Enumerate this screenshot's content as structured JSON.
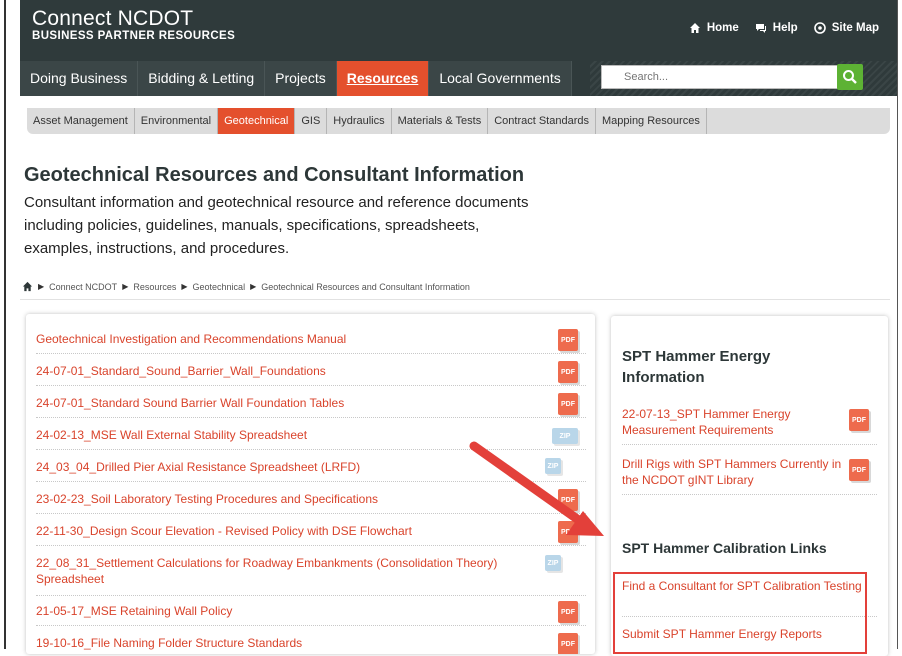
{
  "header": {
    "brand_name": "Connect NCDOT",
    "brand_sub": "BUSINESS PARTNER RESOURCES",
    "top_links": [
      {
        "label": "Home",
        "icon": "home-icon"
      },
      {
        "label": "Help",
        "icon": "chat-icon"
      },
      {
        "label": "Site Map",
        "icon": "sitemap-icon"
      }
    ],
    "nav": [
      "Doing Business",
      "Bidding & Letting",
      "Projects",
      "Resources",
      "Local Governments"
    ],
    "nav_active": "Resources",
    "search_placeholder": "Search..."
  },
  "subnav": {
    "items": [
      "Asset Management",
      "Environmental",
      "Geotechnical",
      "GIS",
      "Hydraulics",
      "Materials & Tests",
      "Contract Standards",
      "Mapping Resources"
    ],
    "active": "Geotechnical"
  },
  "page": {
    "title": "Geotechnical Resources and Consultant Information",
    "intro": "Consultant information and geotechnical resource and reference documents including policies, guidelines, manuals, specifications, spreadsheets, examples, instructions, and procedures."
  },
  "breadcrumb": [
    "Connect NCDOT",
    "Resources",
    "Geotechnical",
    "Geotechnical Resources and Consultant Information"
  ],
  "documents": [
    {
      "title": "Geotechnical Investigation and Recommendations Manual",
      "type": "PDF"
    },
    {
      "title": "24-07-01_Standard_Sound_Barrier_Wall_Foundations",
      "type": "PDF"
    },
    {
      "title": "24-07-01_Standard Sound Barrier Wall Foundation Tables",
      "type": "PDF"
    },
    {
      "title": "24-02-13_MSE Wall External Stability Spreadsheet",
      "type": "ZIP"
    },
    {
      "title": "24_03_04_Drilled Pier Axial Resistance Spreadsheet (LRFD)",
      "type": "ZIP"
    },
    {
      "title": "23-02-23_Soil Laboratory Testing Procedures and Specifications",
      "type": "PDF"
    },
    {
      "title": "22-11-30_Design Scour Elevation - Revised Policy with DSE Flowchart",
      "type": "PDF"
    },
    {
      "title": "22_08_31_Settlement Calculations for Roadway Embankments (Consolidation Theory) Spreadsheet",
      "type": "ZIP"
    },
    {
      "title": "21-05-17_MSE Retaining Wall Policy",
      "type": "PDF"
    },
    {
      "title": "19-10-16_File Naming Folder Structure Standards",
      "type": "PDF"
    }
  ],
  "side": {
    "section1_title": "SPT Hammer Energy Information",
    "section1_items": [
      {
        "title": "22-07-13_SPT Hammer Energy Measurement Requirements",
        "type": "PDF"
      },
      {
        "title": "Drill Rigs with SPT Hammers Currently in the NCDOT gINT Library",
        "type": "PDF"
      }
    ],
    "section2_title": "SPT Hammer Calibration Links",
    "section2_items": [
      {
        "title": "Find a Consultant for SPT Calibration Testing"
      },
      {
        "title": "Submit SPT Hammer Energy Reports"
      }
    ]
  },
  "colors": {
    "accent": "#e4502d",
    "header_bg": "#2f3a3b",
    "link": "#d9432b",
    "search_button": "#5db234",
    "annotation": "#e3403a"
  }
}
